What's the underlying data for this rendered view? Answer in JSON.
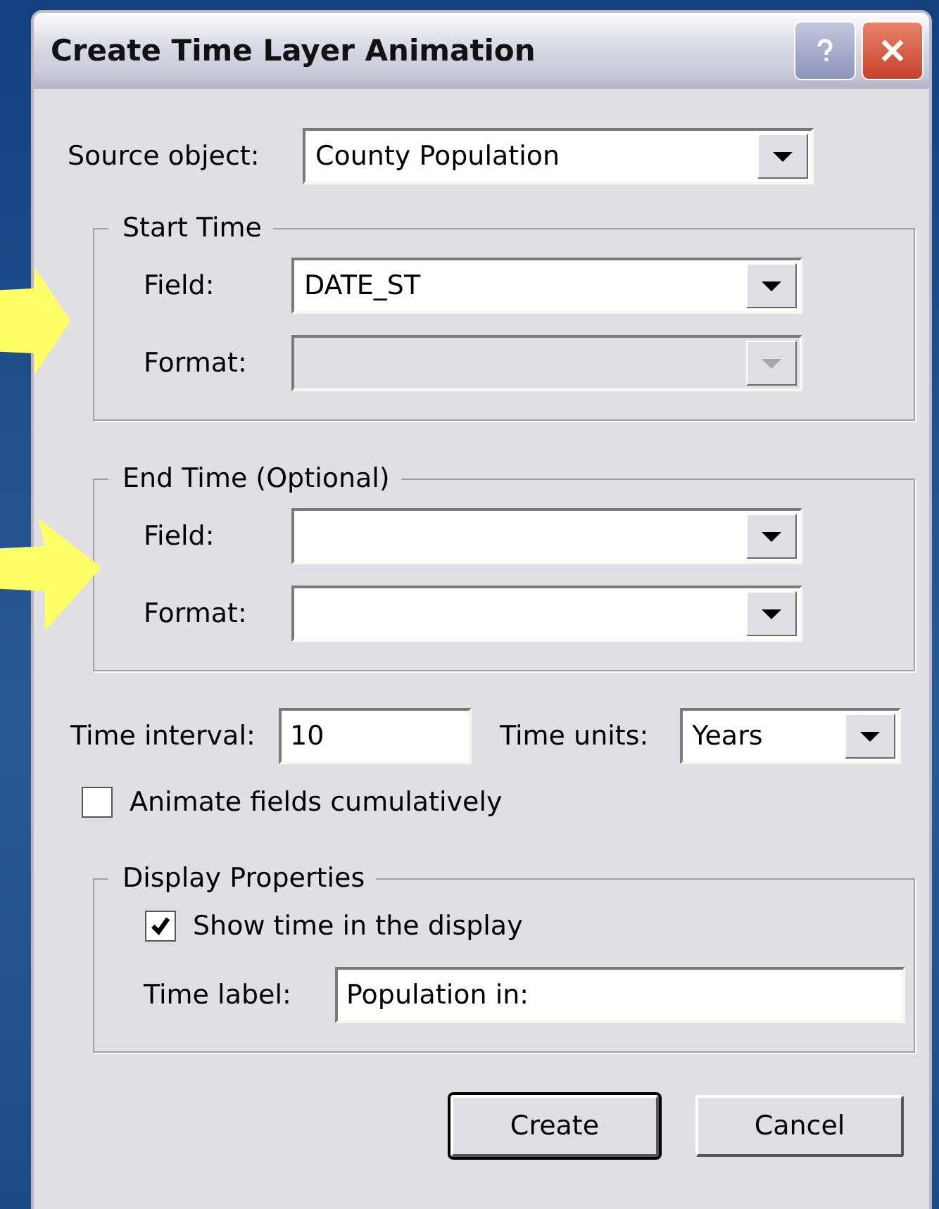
{
  "window": {
    "title": "Create Time Layer Animation"
  },
  "source": {
    "label": "Source object:",
    "value": "County Population"
  },
  "groups": [
    {
      "title": "Start Time",
      "rows": [
        {
          "label": "Field:",
          "value": "DATE_ST",
          "disabled": false
        },
        {
          "label": "Format:",
          "disabled": true
        }
      ]
    },
    {
      "title": "End Time (Optional)",
      "rows": [
        {
          "label": "Field:",
          "disabled": false
        },
        {
          "label": "Format:",
          "disabled": false
        }
      ]
    }
  ],
  "interval": {
    "label": "Time interval:",
    "value": "10"
  },
  "units": {
    "label": "Time units:",
    "value": "Years"
  },
  "animate": {
    "label": "Animate fields cumulatively",
    "checked": false
  },
  "display": {
    "title": "Display Properties",
    "show_time": {
      "label": "Show time in the display",
      "checked": true
    },
    "time_label": {
      "label": "Time label:",
      "value": "Population in:"
    }
  },
  "buttons": [
    {
      "label": "Create",
      "default": true
    },
    {
      "label": "Cancel",
      "default": false
    }
  ]
}
